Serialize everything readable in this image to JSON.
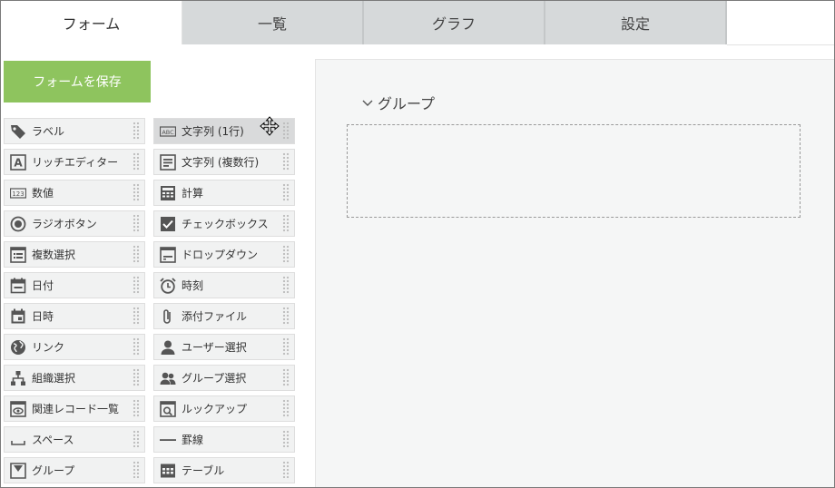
{
  "tabs": [
    {
      "label": "フォーム",
      "active": true
    },
    {
      "label": "一覧",
      "active": false
    },
    {
      "label": "グラフ",
      "active": false
    },
    {
      "label": "設定",
      "active": false
    }
  ],
  "save_button": {
    "label": "フォームを保存",
    "color": "#8ec45e"
  },
  "palette": {
    "left": [
      {
        "label": "ラベル",
        "icon": "tag-icon"
      },
      {
        "label": "リッチエディター",
        "icon": "rich-text-icon"
      },
      {
        "label": "数値",
        "icon": "number-icon"
      },
      {
        "label": "ラジオボタン",
        "icon": "radio-icon"
      },
      {
        "label": "複数選択",
        "icon": "multi-select-icon"
      },
      {
        "label": "日付",
        "icon": "date-icon"
      },
      {
        "label": "日時",
        "icon": "datetime-icon"
      },
      {
        "label": "リンク",
        "icon": "globe-icon"
      },
      {
        "label": "組織選択",
        "icon": "org-chart-icon"
      },
      {
        "label": "関連レコード一覧",
        "icon": "related-records-icon"
      },
      {
        "label": "スペース",
        "icon": "space-icon"
      },
      {
        "label": "グループ",
        "icon": "group-icon"
      }
    ],
    "right": [
      {
        "label": "文字列 (1行)",
        "icon": "abc-icon"
      },
      {
        "label": "文字列 (複数行)",
        "icon": "multiline-text-icon"
      },
      {
        "label": "計算",
        "icon": "calculator-icon"
      },
      {
        "label": "チェックボックス",
        "icon": "checkbox-icon"
      },
      {
        "label": "ドロップダウン",
        "icon": "dropdown-icon"
      },
      {
        "label": "時刻",
        "icon": "alarm-clock-icon"
      },
      {
        "label": "添付ファイル",
        "icon": "paperclip-icon"
      },
      {
        "label": "ユーザー選択",
        "icon": "user-icon"
      },
      {
        "label": "グループ選択",
        "icon": "users-icon"
      },
      {
        "label": "ルックアップ",
        "icon": "lookup-icon"
      },
      {
        "label": "罫線",
        "icon": "line-icon"
      },
      {
        "label": "テーブル",
        "icon": "table-icon"
      }
    ]
  },
  "canvas": {
    "group_title": "グループ",
    "collapse_icon": "chevron-down-icon"
  }
}
